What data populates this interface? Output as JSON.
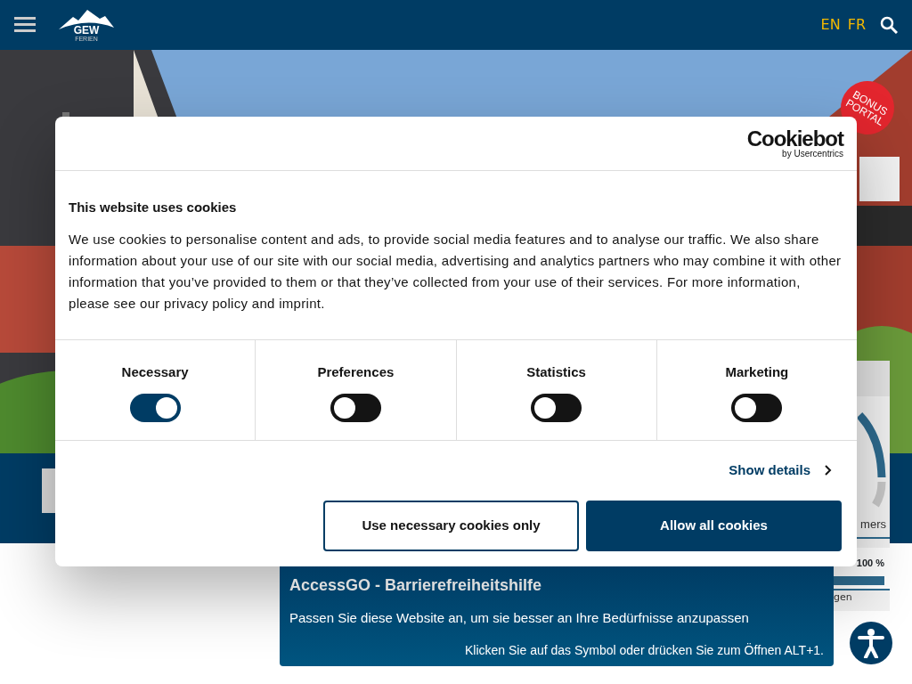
{
  "header": {
    "logo": {
      "name": "GEW",
      "tagline": "FERIEN"
    },
    "languages": [
      {
        "label": "EN"
      },
      {
        "label": "FR"
      }
    ]
  },
  "bonus_badge": {
    "lines": [
      "BONUS",
      "PORTAL"
    ]
  },
  "side_widget": {
    "gauge_label": "mers",
    "percent": "100 %",
    "level": 1,
    "footer": "gen"
  },
  "cookie_dialog": {
    "brand": "Cookiebot",
    "brand_sub": "by Usercentrics",
    "title": "This website uses cookies",
    "text": "We use cookies to personalise content and ads, to provide social media features and to analyse our traffic. We also share information about your use of our site with our social media, advertising and analytics partners who may combine it with other information that you’ve provided to them or that they’ve collected from your use of their services. For more information, please see our privacy policy and imprint.",
    "categories": [
      {
        "label": "Necessary",
        "on": true
      },
      {
        "label": "Preferences",
        "on": false
      },
      {
        "label": "Statistics",
        "on": false
      },
      {
        "label": "Marketing",
        "on": false
      }
    ],
    "details_link": "Show details",
    "buttons": [
      {
        "label": "Use necessary cookies only",
        "kind": "outline"
      },
      {
        "label": "Allow all cookies",
        "kind": "primary"
      }
    ]
  },
  "accessibility_popup": {
    "title": "AccessGO - Barrierefreiheitshilfe",
    "text": "Passen Sie diese Website an, um sie besser an Ihre Bedürfnisse anzupassen",
    "hint": "Klicken Sie auf das Symbol oder drücken Sie zum Öffnen ALT+1."
  }
}
